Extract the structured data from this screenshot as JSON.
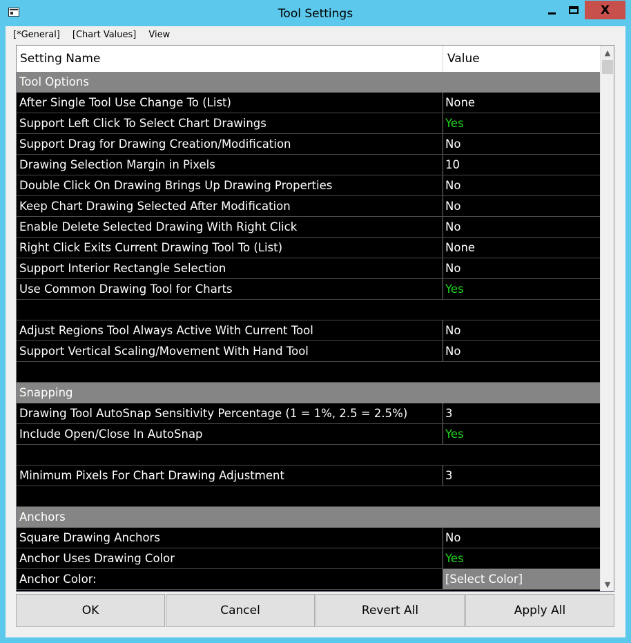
{
  "window": {
    "title": "Tool Settings",
    "close_glyph": "X"
  },
  "menu": {
    "items": [
      "[*General]",
      "[Chart Values]",
      "View"
    ]
  },
  "grid": {
    "headers": {
      "name": "Setting Name",
      "value": "Value"
    },
    "rows": [
      {
        "kind": "section",
        "name": "Tool Options",
        "value": ""
      },
      {
        "kind": "setting",
        "name": "After Single Tool Use Change To (List)",
        "value": "None"
      },
      {
        "kind": "setting",
        "name": "Support Left Click To Select Chart Drawings",
        "value": "Yes"
      },
      {
        "kind": "setting",
        "name": "Support Drag for Drawing Creation/Modification",
        "value": "No"
      },
      {
        "kind": "setting",
        "name": "Drawing Selection Margin in Pixels",
        "value": "10"
      },
      {
        "kind": "setting",
        "name": "Double Click On Drawing Brings Up Drawing Properties",
        "value": "No"
      },
      {
        "kind": "setting",
        "name": "Keep Chart Drawing Selected After Modification",
        "value": "No"
      },
      {
        "kind": "setting",
        "name": "Enable Delete Selected Drawing With Right Click",
        "value": "No"
      },
      {
        "kind": "setting",
        "name": "Right Click Exits Current Drawing Tool To (List)",
        "value": "None"
      },
      {
        "kind": "setting",
        "name": "Support Interior Rectangle Selection",
        "value": "No"
      },
      {
        "kind": "setting",
        "name": "Use Common Drawing Tool for Charts",
        "value": "Yes"
      },
      {
        "kind": "blank",
        "name": "",
        "value": ""
      },
      {
        "kind": "setting",
        "name": "Adjust Regions Tool Always Active With Current Tool",
        "value": "No"
      },
      {
        "kind": "setting",
        "name": "Support Vertical Scaling/Movement With Hand Tool",
        "value": "No"
      },
      {
        "kind": "blank",
        "name": "",
        "value": ""
      },
      {
        "kind": "section",
        "name": "Snapping",
        "value": ""
      },
      {
        "kind": "setting",
        "name": "Drawing Tool AutoSnap Sensitivity Percentage (1 = 1%, 2.5 = 2.5%)",
        "value": "3"
      },
      {
        "kind": "setting",
        "name": "Include Open/Close In AutoSnap",
        "value": "Yes"
      },
      {
        "kind": "blank",
        "name": "",
        "value": ""
      },
      {
        "kind": "setting",
        "name": "Minimum Pixels For Chart Drawing Adjustment",
        "value": "3"
      },
      {
        "kind": "blank",
        "name": "",
        "value": ""
      },
      {
        "kind": "section",
        "name": "Anchors",
        "value": ""
      },
      {
        "kind": "setting",
        "name": "Square Drawing Anchors",
        "value": "No"
      },
      {
        "kind": "setting",
        "name": "Anchor Uses Drawing Color",
        "value": "Yes"
      },
      {
        "kind": "setting",
        "name": "Anchor Color:",
        "value": "[Select Color]"
      }
    ]
  },
  "buttons": {
    "ok": "OK",
    "cancel": "Cancel",
    "revert_all": "Revert All",
    "apply_all": "Apply All"
  },
  "colors": {
    "titlebar": "#5bc8ec",
    "close": "#c7504d",
    "section": "#858585",
    "yes": "#1fd61f"
  },
  "icons": {
    "app": "window-icon",
    "minimize": "minimize-icon",
    "maximize": "maximize-icon",
    "close": "close-icon",
    "scroll_up": "chevron-up-icon",
    "scroll_down": "chevron-down-icon"
  }
}
